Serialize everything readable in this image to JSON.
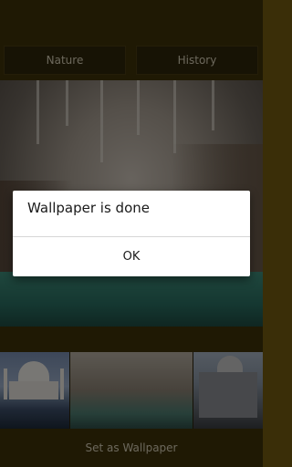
{
  "tabs": {
    "left_label": "Nature",
    "right_label": "History"
  },
  "bottom": {
    "set_wallpaper_label": "Set as Wallpaper"
  },
  "dialog": {
    "message": "Wallpaper is done",
    "ok_label": "OK"
  },
  "thumbnails": [
    "taj-mahal-thumb",
    "cave-thumb",
    "mosque-thumb"
  ],
  "colors": {
    "bar": "#3f3309",
    "dialog_bg": "#ffffff"
  }
}
